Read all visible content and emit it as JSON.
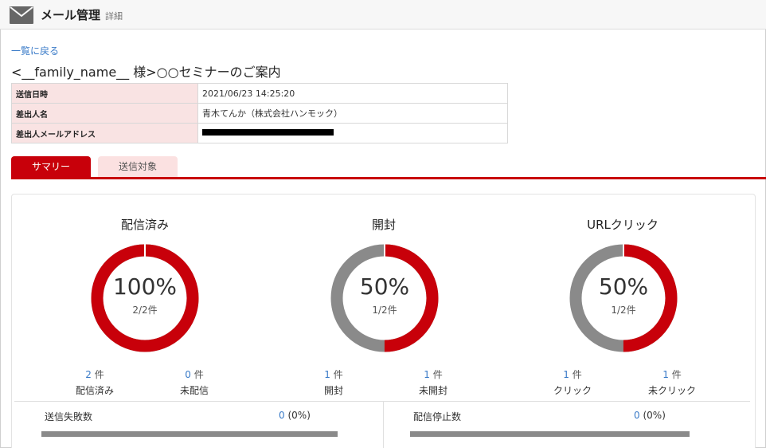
{
  "header": {
    "title": "メール管理",
    "subtitle": "詳細"
  },
  "back_link": "一覧に戻る",
  "subject": "<__family_name__ 様>○○セミナーのご案内",
  "info": [
    {
      "key": "送信日時",
      "value": "2021/06/23 14:25:20"
    },
    {
      "key": "差出人名",
      "value": "青木てんか（株式会社ハンモック）"
    },
    {
      "key": "差出人メールアドレス",
      "value": ""
    }
  ],
  "tabs": [
    {
      "label": "サマリー",
      "active": true
    },
    {
      "label": "送信対象",
      "active": false
    }
  ],
  "metrics": [
    {
      "title": "配信済み",
      "percent": "100%",
      "count": "2/2件",
      "fraction": 1.0,
      "left": {
        "num": "2",
        "unit": "件",
        "label": "配信済み"
      },
      "right": {
        "num": "0",
        "unit": "件",
        "label": "未配信"
      }
    },
    {
      "title": "開封",
      "percent": "50%",
      "count": "1/2件",
      "fraction": 0.5,
      "left": {
        "num": "1",
        "unit": "件",
        "label": "開封"
      },
      "right": {
        "num": "1",
        "unit": "件",
        "label": "未開封"
      }
    },
    {
      "title": "URLクリック",
      "percent": "50%",
      "count": "1/2件",
      "fraction": 0.5,
      "left": {
        "num": "1",
        "unit": "件",
        "label": "クリック"
      },
      "right": {
        "num": "1",
        "unit": "件",
        "label": "未クリック"
      }
    }
  ],
  "bottom": [
    {
      "label": "送信失敗数",
      "num": "0",
      "pct": "(0%)"
    },
    {
      "label": "配信停止数",
      "num": "0",
      "pct": "(0%)"
    }
  ],
  "colors": {
    "accent": "#c8000a",
    "ring_empty": "#8a8a8a",
    "link": "#3a7bc8",
    "key_bg": "#f9e3e3"
  }
}
